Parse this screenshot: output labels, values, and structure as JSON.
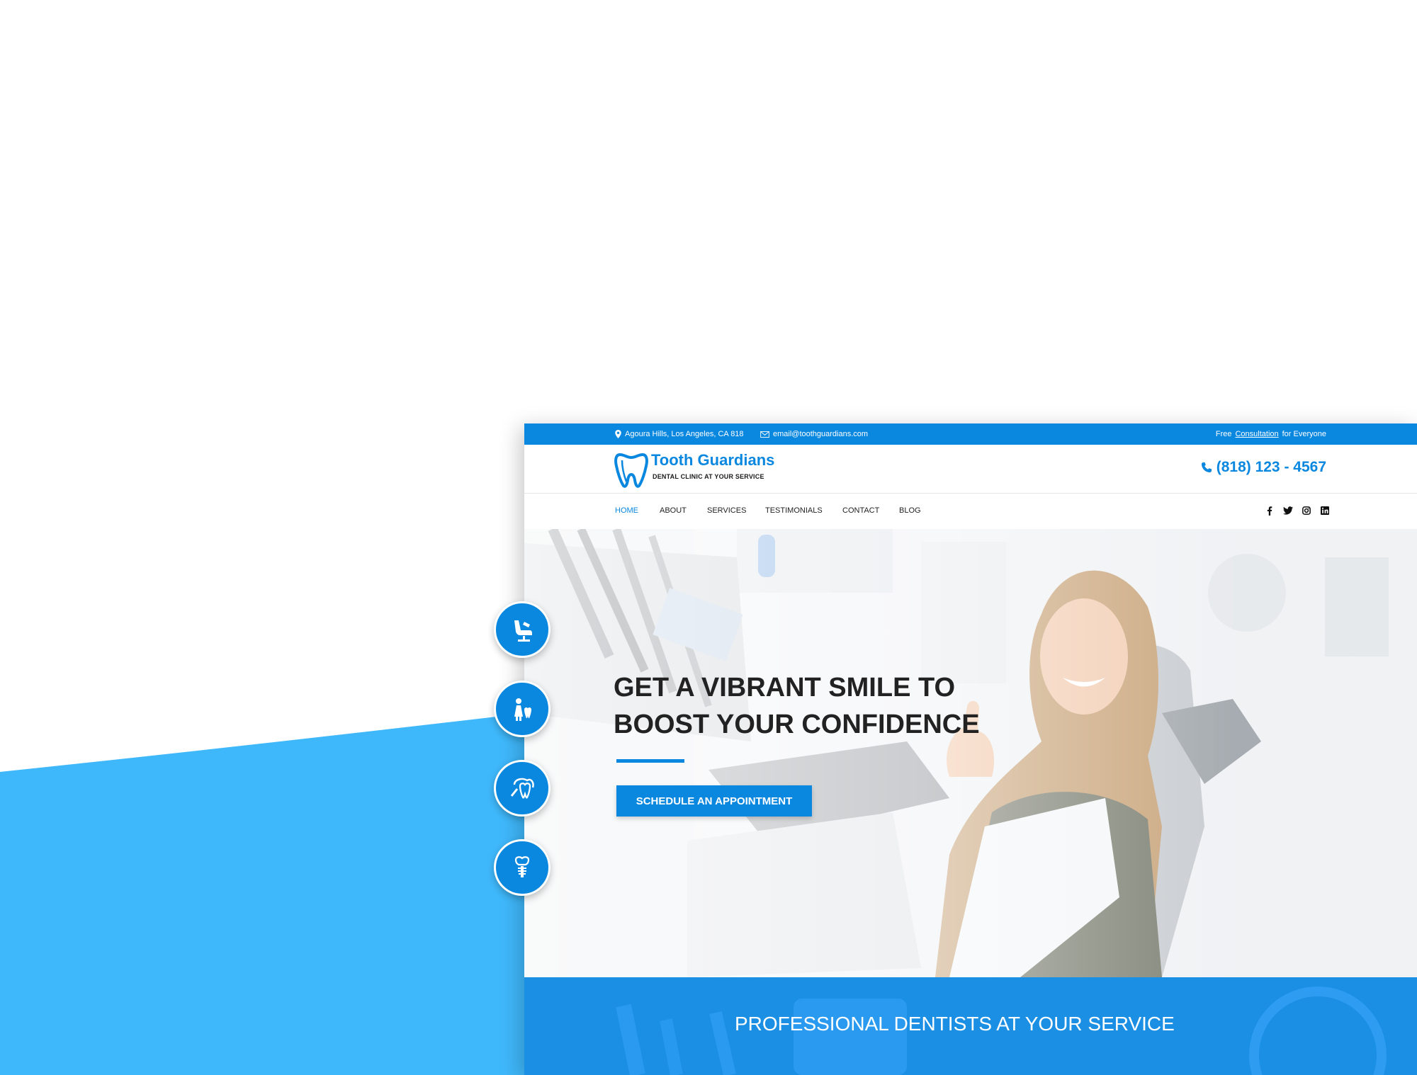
{
  "colors": {
    "brand_blue": "#0a87df",
    "light_blue": "#3fb8fb",
    "text_dark": "#222222",
    "white": "#ffffff"
  },
  "topbar": {
    "address": "Agoura Hills, Los Angeles, CA 818",
    "email": "email@toothguardians.com",
    "promo_prefix": "Free",
    "promo_link": "Consultation",
    "promo_suffix": "for Everyone"
  },
  "header": {
    "logo_name": "Tooth Guardians",
    "logo_tagline": "DENTAL CLINIC AT YOUR SERVICE",
    "phone": "(818) 123 - 4567"
  },
  "nav": {
    "items": [
      {
        "label": "HOME",
        "active": true
      },
      {
        "label": "ABOUT"
      },
      {
        "label": "SERVICES"
      },
      {
        "label": "TESTIMONIALS"
      },
      {
        "label": "CONTACT"
      },
      {
        "label": "BLOG"
      }
    ],
    "social": [
      "facebook-icon",
      "twitter-icon",
      "instagram-icon",
      "linkedin-icon"
    ]
  },
  "hero": {
    "title": "GET A VIBRANT SMILE TO BOOST YOUR CONFIDENCE",
    "cta": "SCHEDULE AN APPOINTMENT"
  },
  "band": {
    "text": "PROFESSIONAL DENTISTS AT YOUR SERVICE"
  },
  "feature_icons": [
    "dental-chair-icon",
    "family-dentistry-icon",
    "tooth-care-icon",
    "dental-implant-icon"
  ]
}
